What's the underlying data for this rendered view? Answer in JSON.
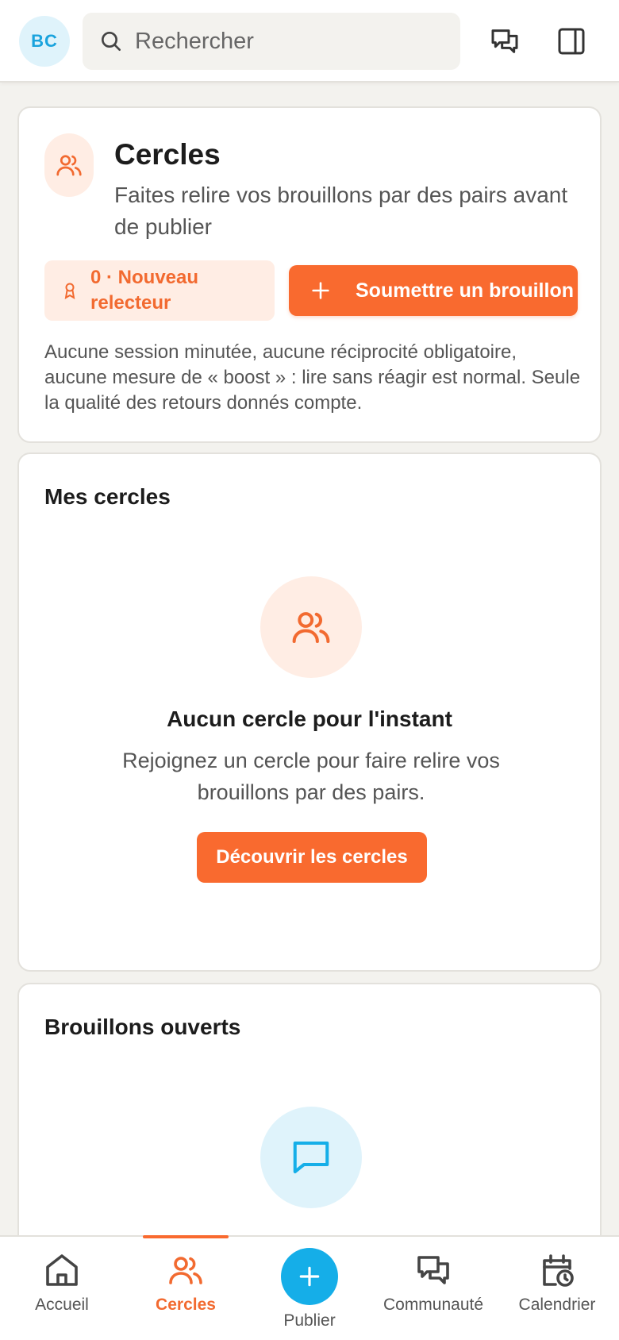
{
  "header": {
    "avatar_initials": "BC",
    "search_placeholder": "Rechercher",
    "icons": [
      "search-icon",
      "messages-icon",
      "sidebar-panel-icon"
    ]
  },
  "intro": {
    "title": "Cercles",
    "subtitle": "Faites relire vos brouillons par des pairs avant de publier",
    "badge": "0 · Nouveau relecteur",
    "submit_label": "Soumettre un brouillon",
    "note": "Aucune session minutée, aucune réciprocité obligatoire, aucune mesure de « boost » : lire sans réagir est normal. Seule la qualité des retours donnés compte."
  },
  "my_circles": {
    "title": "Mes cercles",
    "empty_title": "Aucun cercle pour l'instant",
    "empty_sub": "Rejoignez un cercle pour faire relire vos brouillons par des pairs.",
    "discover_label": "Découvrir les cercles"
  },
  "open_drafts": {
    "title": "Brouillons ouverts"
  },
  "nav": {
    "home": "Accueil",
    "circles": "Cercles",
    "publish": "Publier",
    "community": "Communauté",
    "calendar": "Calendrier"
  },
  "colors": {
    "accent": "#f96a2f",
    "accent_soft": "#ffede4",
    "blue": "#15aee8",
    "blue_soft": "#dff3fb",
    "background": "#f3f2ee"
  }
}
